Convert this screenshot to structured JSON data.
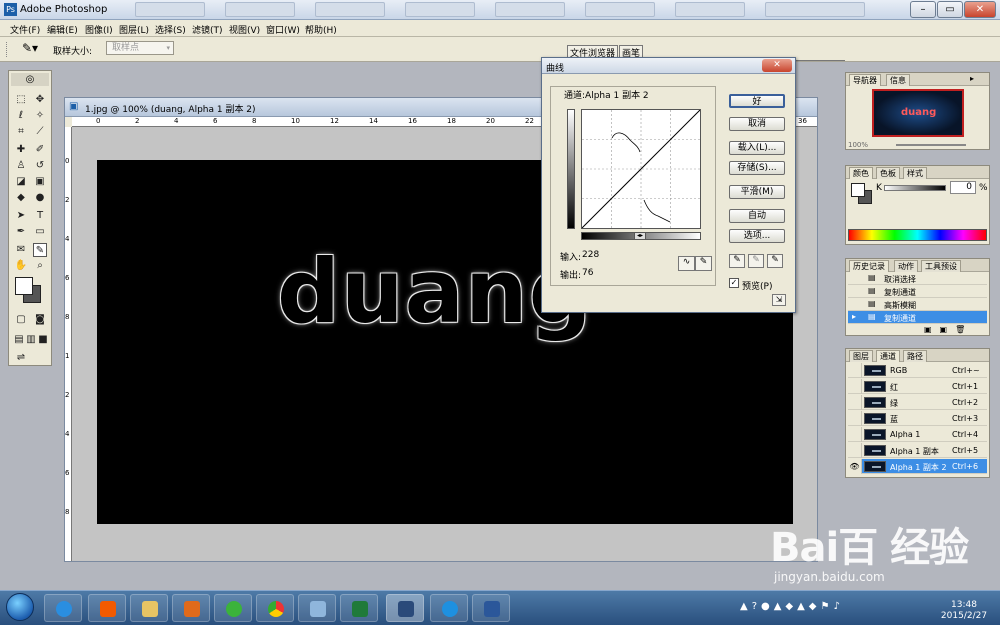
{
  "app": {
    "title": "Adobe Photoshop"
  },
  "menu": [
    "文件(F)",
    "编辑(E)",
    "图像(I)",
    "图层(L)",
    "选择(S)",
    "滤镜(T)",
    "视图(V)",
    "窗口(W)",
    "帮助(H)"
  ],
  "options": {
    "sample_size_label": "取样大小:",
    "sample_size_value": "取样点",
    "tabs": [
      "文件浏览器",
      "画笔"
    ]
  },
  "document": {
    "title": "1.jpg @ 100% (duang, Alpha 1 副本 2)",
    "canvas_text": "duang",
    "ruler_top": [
      "0",
      "2",
      "4",
      "6",
      "8",
      "10",
      "12",
      "14",
      "16",
      "18",
      "20",
      "22",
      "24",
      "26",
      "28",
      "30",
      "32",
      "34",
      "36"
    ],
    "ruler_left": [
      "0",
      "2",
      "4",
      "6",
      "8",
      "1",
      "2",
      "4",
      "6",
      "8"
    ]
  },
  "curves": {
    "title": "曲线",
    "channel_label": "通道:Alpha 1 副本 2",
    "input_label": "输入:",
    "input_value": "228",
    "output_label": "输出:",
    "output_value": "76",
    "buttons": [
      "好",
      "取消",
      "载入(L)...",
      "存储(S)...",
      "平滑(M)",
      "自动",
      "选项..."
    ],
    "preview_label": "预览(P)",
    "preview_checked": true
  },
  "navigator": {
    "tabs": [
      "导航器",
      "信息"
    ],
    "zoom": "100%",
    "thumb_text": "duang"
  },
  "color": {
    "tabs": [
      "颜色",
      "色板",
      "样式"
    ],
    "channel": "K",
    "value": "0",
    "unit": "%"
  },
  "history": {
    "tabs": [
      "历史记录",
      "动作",
      "工具预设"
    ],
    "items": [
      "取消选择",
      "复制通道",
      "高斯模糊",
      "复制通道"
    ]
  },
  "channels": {
    "tabs": [
      "图层",
      "通道",
      "路径"
    ],
    "rows": [
      {
        "name": "RGB",
        "shortcut": "Ctrl+~"
      },
      {
        "name": "红",
        "shortcut": "Ctrl+1"
      },
      {
        "name": "绿",
        "shortcut": "Ctrl+2"
      },
      {
        "name": "蓝",
        "shortcut": "Ctrl+3"
      },
      {
        "name": "Alpha 1",
        "shortcut": "Ctrl+4"
      },
      {
        "name": "Alpha 1 副本",
        "shortcut": "Ctrl+5"
      },
      {
        "name": "Alpha 1 副本 2",
        "shortcut": "Ctrl+6"
      }
    ]
  },
  "taskbar": {
    "time": "13:48",
    "date": "2015/2/27"
  },
  "watermark": {
    "logo": "Bai百 经验",
    "url": "jingyan.baidu.com"
  },
  "colors": {
    "selection": "#3d8ee5",
    "canvas": "#000000",
    "dialog_bg": "#ece9d8"
  }
}
